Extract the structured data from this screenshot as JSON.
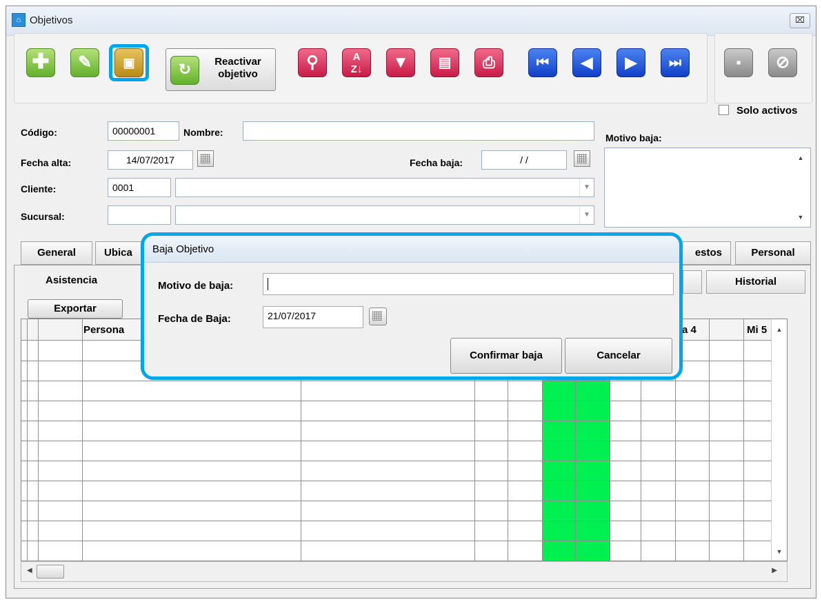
{
  "window": {
    "title": "Objetivos",
    "close_symbol": "⌧"
  },
  "toolbar": {
    "reactivar_line1": "Reactivar",
    "reactivar_line2": "objetivo",
    "colors": {
      "green": "#63b02c",
      "yellow": "#b98a16",
      "red": "#c81c48",
      "blue": "#1140c8",
      "gray": "#8a8a8a",
      "highlight": "#00a6ea"
    }
  },
  "filters": {
    "solo_activos_label": "Solo activos",
    "solo_activos_checked": false
  },
  "form": {
    "codigo_label": "Código:",
    "codigo_value": "00000001",
    "nombre_label": "Nombre:",
    "nombre_value": "",
    "fecha_alta_label": "Fecha alta:",
    "fecha_alta_value": "14/07/2017",
    "fecha_baja_label": "Fecha baja:",
    "fecha_baja_value": "/ /",
    "cliente_label": "Cliente:",
    "cliente_code": "0001",
    "sucursal_label": "Sucursal:",
    "motivo_baja_label": "Motivo baja:"
  },
  "tabs": {
    "general": "General",
    "ubicacion_partial": "Ubica",
    "puestos_partial": "estos",
    "personal": "Personal"
  },
  "subtabs": {
    "asistencia": "Asistencia",
    "historial": "Historial"
  },
  "grid": {
    "exportar_label": "Exportar",
    "col_personal_partial": "Persona",
    "col_day4_partial": "a 4",
    "col_day5": "Mi 5",
    "highlight_color": "#00f052"
  },
  "dialog": {
    "title": "Baja Objetivo",
    "motivo_label": "Motivo de baja:",
    "motivo_value": "",
    "fecha_label": "Fecha de Baja:",
    "fecha_value": "21/07/2017",
    "confirm_label": "Confirmar baja",
    "cancel_label": "Cancelar"
  }
}
